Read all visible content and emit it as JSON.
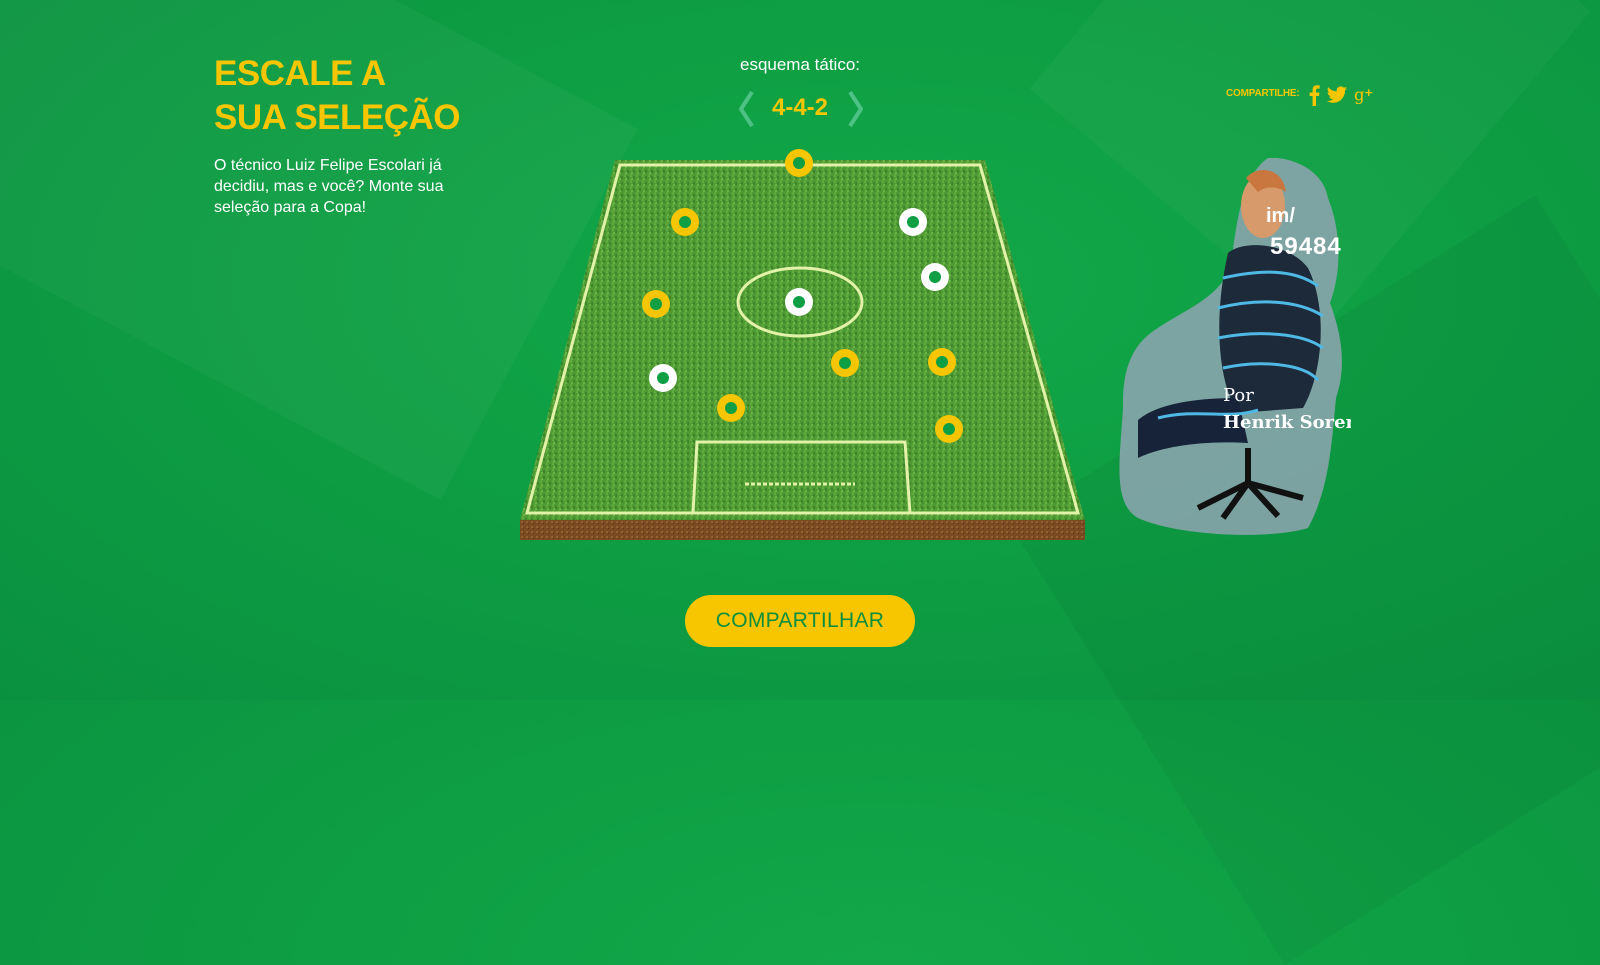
{
  "header": {
    "title_line1": "ESCALE A",
    "title_line2": "SUA SELEÇÃO",
    "intro": "O técnico Luiz Felipe Escolari já decidiu, mas e você? Monte sua seleção para a Copa!"
  },
  "formation": {
    "label": "esquema tático:",
    "value": "4-4-2",
    "prev_icon": "chevron-left-icon",
    "next_icon": "chevron-right-icon"
  },
  "share": {
    "label": "COMPARTILHE:",
    "networks": [
      "facebook-icon",
      "twitter-icon",
      "google-plus-icon"
    ]
  },
  "ad_image": {
    "url_fragment": "im/",
    "number_fragment": "59484",
    "by_label": "Por",
    "author": "Henrik Sorensen"
  },
  "cta": {
    "label": "COMPARTILHAR"
  },
  "colors": {
    "background": "#0e9e43",
    "accent_yellow": "#f7c600",
    "player_green": "#0e9e43",
    "white": "#ffffff"
  }
}
